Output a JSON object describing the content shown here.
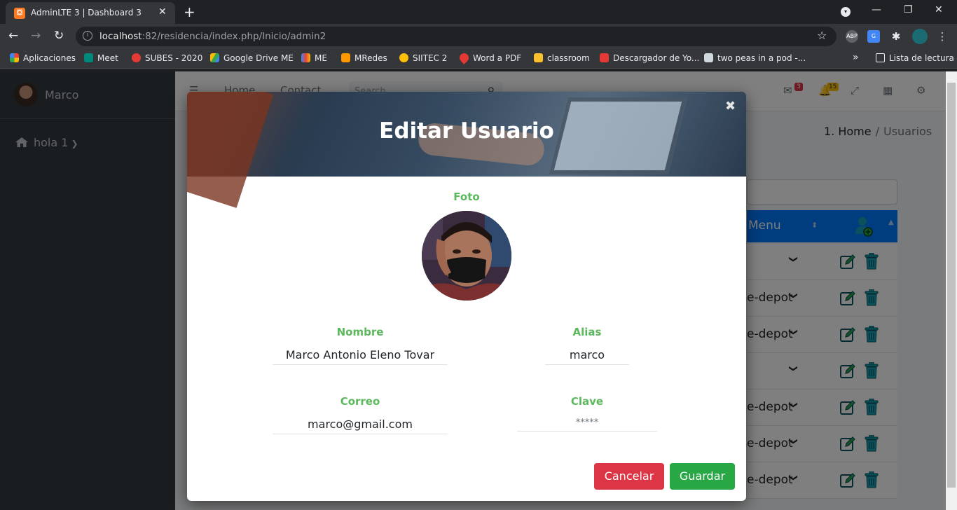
{
  "browser": {
    "tab_title": "AdminLTE 3 | Dashboard 3",
    "favicon_text": "⛋",
    "url_host": "localhost",
    "url_rest": ":82/residencia/index.php/Inicio/admin2",
    "bookmarks": [
      {
        "label": "Aplicaciones",
        "color": "#ea4335"
      },
      {
        "label": "Meet",
        "color": "#00897b"
      },
      {
        "label": "SUBES - 2020",
        "color": "#e53935"
      },
      {
        "label": "Google Drive ME",
        "color": "#fbbc04"
      },
      {
        "label": "ME",
        "color": "#ea4335"
      },
      {
        "label": "MRedes",
        "color": "#ff9800"
      },
      {
        "label": "SIITEC 2",
        "color": "#ffc107"
      },
      {
        "label": "Word a PDF",
        "color": "#e53935"
      },
      {
        "label": "classroom",
        "color": "#fbc02d"
      },
      {
        "label": "Descargador de Yo...",
        "color": "#e53935"
      },
      {
        "label": "two peas in a pod -...",
        "color": "#cfd8dc"
      }
    ],
    "overflow": "»",
    "reading_list": "Lista de lectura"
  },
  "sidebar": {
    "user_name": "Marco",
    "items": [
      {
        "label": "hola 1"
      }
    ]
  },
  "topnav": {
    "home": "Home",
    "contact": "Contact",
    "search_placeholder": "Search",
    "messages_count": "3",
    "notifications_count": "15"
  },
  "breadcrumb": {
    "number": "1.",
    "home": "Home",
    "separator": "/",
    "current": "Usuarios"
  },
  "table": {
    "header_menu": "Menu",
    "rows": [
      {
        "menu": ""
      },
      {
        "menu": "e-depot"
      },
      {
        "menu": "e-depot"
      },
      {
        "menu": ""
      },
      {
        "menu": "e-depot"
      },
      {
        "menu": "e-depot"
      },
      {
        "menu": "e-depot"
      }
    ]
  },
  "modal": {
    "title": "Editar Usuario",
    "close_icon": "✖",
    "foto_label": "Foto",
    "nombre_label": "Nombre",
    "nombre_value": "Marco Antonio Eleno Tovar",
    "alias_label": "Alias",
    "alias_value": "marco",
    "correo_label": "Correo",
    "correo_value": "marco@gmail.com",
    "clave_label": "Clave",
    "clave_placeholder": "*****",
    "cancel_label": "Cancelar",
    "save_label": "Guardar"
  },
  "colors": {
    "label_green": "#5cb85c",
    "danger": "#dc3545",
    "success": "#28a745",
    "table_header": "#007bff",
    "sidebar": "#343a40"
  }
}
